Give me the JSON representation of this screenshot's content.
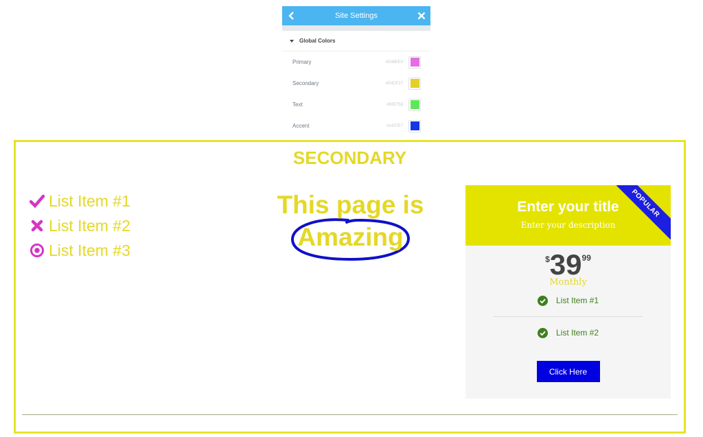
{
  "panel": {
    "title": "Site Settings",
    "back_icon": "chevron-left-icon",
    "close_icon": "close-icon",
    "section_title": "Global Colors",
    "colors": [
      {
        "name": "Primary",
        "hex": "#E46EE0",
        "color": "#e46ee0"
      },
      {
        "name": "Secondary",
        "hex": "#E4CF27",
        "color": "#e4cf27"
      },
      {
        "name": "Text",
        "hex": "#60E759",
        "color": "#60e759"
      },
      {
        "name": "Accent",
        "hex": "#1437E7",
        "color": "#1437e7"
      }
    ]
  },
  "preview": {
    "heading": "SECONDARY",
    "icon_list": [
      {
        "icon": "check-icon",
        "label": "List Item #1"
      },
      {
        "icon": "times-icon",
        "label": "List Item #2"
      },
      {
        "icon": "dot-circle-icon",
        "label": "List Item #3"
      }
    ],
    "headline_line1": "This page is",
    "headline_line2": "Amazing",
    "price_table": {
      "title": "Enter your title",
      "description": "Enter your description",
      "ribbon": "POPULAR",
      "currency": "$",
      "integer": "39",
      "fraction": "99",
      "period": "Monthly",
      "features": [
        "List Item #1",
        "List Item #2"
      ],
      "button": "Click Here"
    }
  }
}
